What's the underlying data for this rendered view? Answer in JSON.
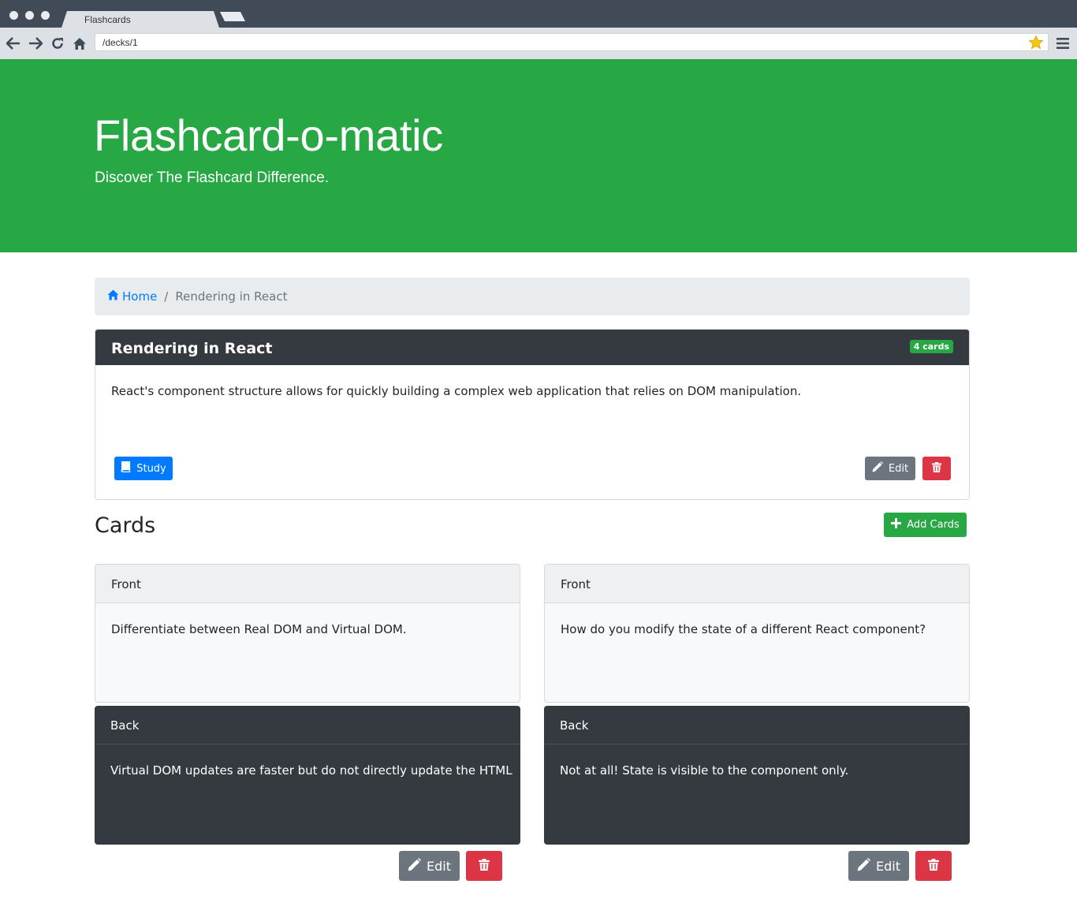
{
  "browser": {
    "tab_title": "Flashcards",
    "url": "/decks/1",
    "icons": [
      "back-icon",
      "forward-icon",
      "reload-icon",
      "home-icon",
      "star-icon",
      "menu-icon"
    ]
  },
  "jumbotron": {
    "title": "Flashcard-o-matic",
    "subtitle": "Discover The Flashcard Difference."
  },
  "breadcrumb": {
    "home_label": "Home",
    "separator": "/",
    "current": "Rendering in React"
  },
  "deck": {
    "title": "Rendering in React",
    "card_count": "4 cards",
    "description": "React's component structure allows for quickly building a complex web application that relies on DOM manipulation.",
    "study_label": "Study",
    "edit_label": "Edit"
  },
  "cards_section": {
    "title": "Cards",
    "add_label": "Add Cards"
  },
  "cards": [
    {
      "front_label": "Front",
      "front": "Differentiate between Real DOM and Virtual DOM.",
      "back_label": "Back",
      "back": "Virtual DOM updates are faster but do not directly update the HTML",
      "edit_label": "Edit"
    },
    {
      "front_label": "Front",
      "front": "How do you modify the state of a different React component?",
      "back_label": "Back",
      "back": "Not at all! State is visible to the component only.",
      "edit_label": "Edit"
    }
  ],
  "colors": {
    "primary": "#007bff",
    "success": "#28a745",
    "danger": "#dc3545",
    "secondary": "#6c757d",
    "dark": "#343a40"
  }
}
